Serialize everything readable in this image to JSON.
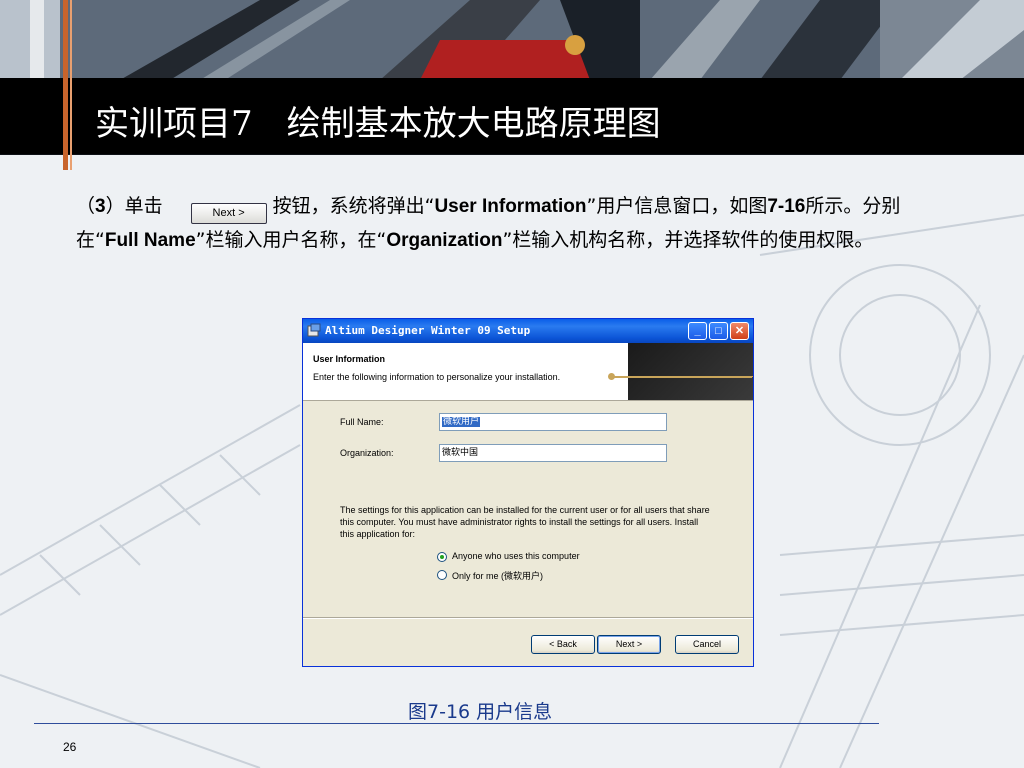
{
  "slide": {
    "title": "实训项目7　绘制基本放大电路原理图",
    "caption": "图7-16 用户信息",
    "page_number": "26"
  },
  "body": {
    "p1": "（",
    "p2": "3",
    "p3": "）单击",
    "next_inline": "Next >",
    "p4": "按钮，系统将弹出“",
    "p5": "User Information",
    "p6": "”用户信息窗口，如图",
    "p7": "7-16",
    "p8": "所示。分别在“",
    "p9": "Full  Name",
    "p10": "”栏输入用户名称，在“",
    "p11": "Organization",
    "p12": "”栏输入机构名称，并选择软件的使用权限。"
  },
  "dialog": {
    "title": "Altium Designer Winter 09 Setup",
    "minimize": "_",
    "maximize": "□",
    "close": "✕",
    "header_title": "User Information",
    "header_subtitle": "Enter the following information to personalize your installation.",
    "full_name_label": "Full Name:",
    "full_name_value": "微软用户",
    "organization_label": "Organization:",
    "organization_value": "微软中国",
    "description": "The settings for this application can be installed for the current user or for all users that share this computer. You must have administrator rights to install the settings for all users. Install this application for:",
    "radio_anyone": "Anyone who uses this computer",
    "radio_only_me": "Only for me (微软用户)",
    "back_button": "< Back",
    "next_button": "Next >",
    "cancel_button": "Cancel"
  },
  "colors": {
    "title_bg": "#000000",
    "accent_rule": "#c8642c",
    "caption": "#1a3a8c",
    "xp_titlebar": "#0b54d6"
  }
}
